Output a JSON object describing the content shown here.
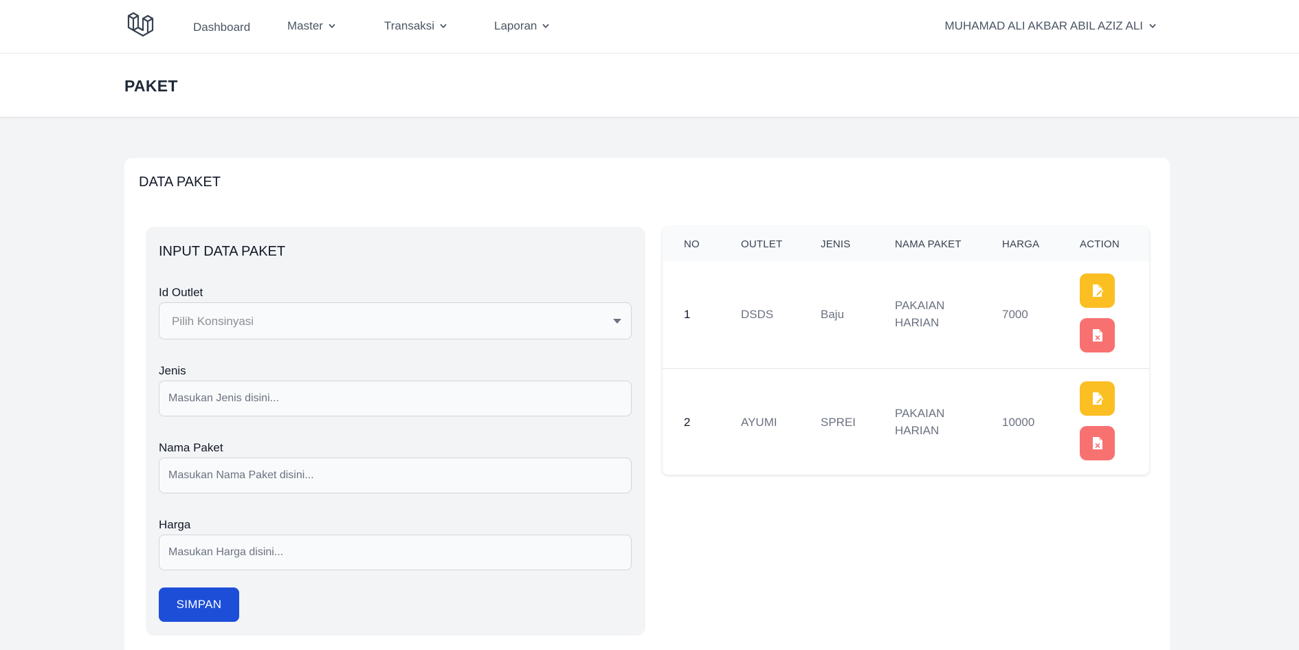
{
  "nav": {
    "dashboard": "Dashboard",
    "master": "Master",
    "transaksi": "Transaksi",
    "laporan": "Laporan",
    "user": "MUHAMAD ALI AKBAR ABIL AZIZ ALI"
  },
  "page": {
    "title": "PAKET"
  },
  "card": {
    "title": "DATA PAKET"
  },
  "form": {
    "title": "INPUT DATA PAKET",
    "outlet_label": "Id Outlet",
    "outlet_placeholder": "Pilih Konsinyasi",
    "jenis_label": "Jenis",
    "jenis_placeholder": "Masukan Jenis disini...",
    "nama_label": "Nama Paket",
    "nama_placeholder": "Masukan Nama Paket disini...",
    "harga_label": "Harga",
    "harga_placeholder": "Masukan Harga disini...",
    "submit": "SIMPAN"
  },
  "table": {
    "headers": [
      "NO",
      "OUTLET",
      "JENIS",
      "NAMA PAKET",
      "HARGA",
      "ACTION"
    ],
    "rows": [
      {
        "no": "1",
        "outlet": "DSDS",
        "jenis": "Baju",
        "nama": [
          "PAKAIAN",
          "HARIAN"
        ],
        "harga": "7000"
      },
      {
        "no": "2",
        "outlet": "AYUMI",
        "jenis": "SPREI",
        "nama": [
          "PAKAIAN",
          "HARIAN"
        ],
        "harga": "10000"
      }
    ]
  },
  "icons": {
    "logo": "laravel-logo",
    "edit": "edit-file-icon",
    "delete": "delete-file-icon",
    "dropdown": "chevron-down-icon"
  },
  "colors": {
    "primary": "#1d4ed8",
    "edit": "#fbbf24",
    "delete": "#f87171"
  }
}
